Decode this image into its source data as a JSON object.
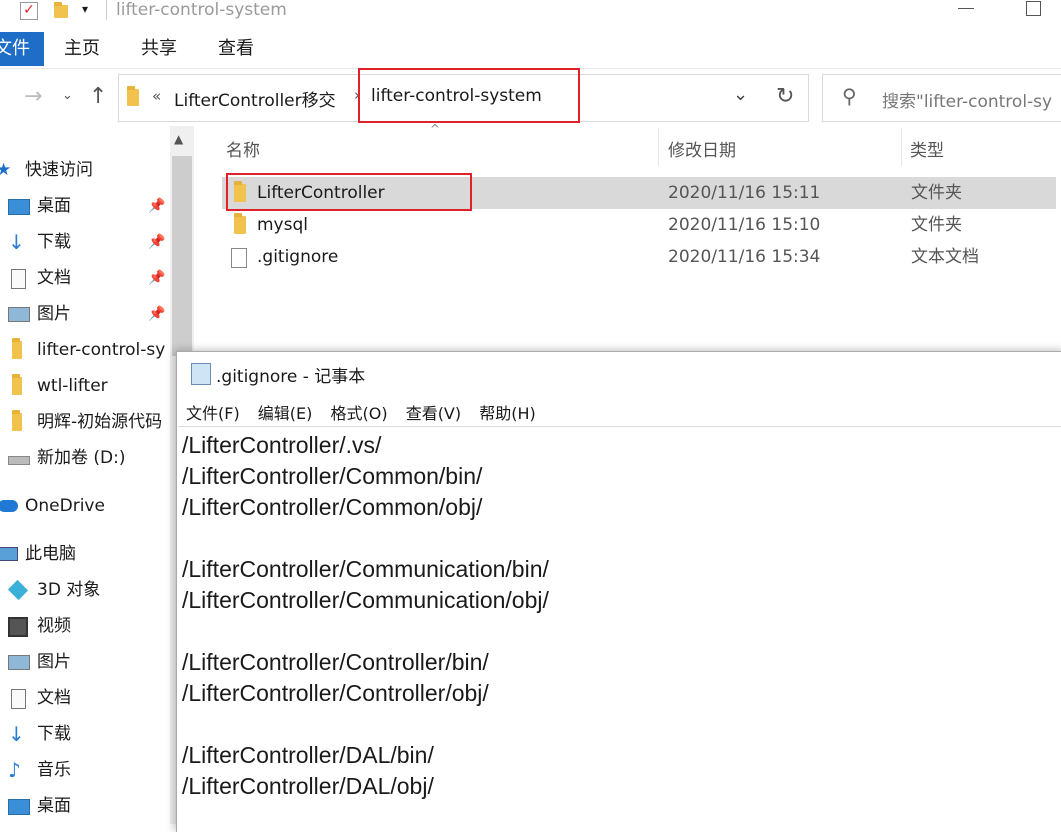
{
  "window": {
    "title": "lifter-control-system"
  },
  "ribbon": {
    "file": "文件",
    "home": "主页",
    "share": "共享",
    "view": "查看"
  },
  "nav": {
    "breadcrumb_sep": "«",
    "crumb_parent": "LifterController移交",
    "crumb_current": "lifter-control-system",
    "search_placeholder": "搜索\"lifter-control-sy"
  },
  "columns": {
    "name": "名称",
    "date": "修改日期",
    "type": "类型"
  },
  "files": [
    {
      "name": "LifterController",
      "date": "2020/11/16 15:11",
      "type": "文件夹",
      "icon": "folder-icon"
    },
    {
      "name": "mysql",
      "date": "2020/11/16 15:10",
      "type": "文件夹",
      "icon": "folder-icon"
    },
    {
      "name": ".gitignore",
      "date": "2020/11/16 15:34",
      "type": "文本文档",
      "icon": "text-file-icon"
    }
  ],
  "sidebar": {
    "quick_access": "快速访问",
    "items": [
      {
        "label": "桌面",
        "icon": "desktop-icon",
        "pinned": true
      },
      {
        "label": "下载",
        "icon": "download-icon",
        "pinned": true
      },
      {
        "label": "文档",
        "icon": "document-icon",
        "pinned": true
      },
      {
        "label": "图片",
        "icon": "picture-icon",
        "pinned": true
      },
      {
        "label": "lifter-control-sy",
        "icon": "folder-icon",
        "pinned": false
      },
      {
        "label": "wtl-lifter",
        "icon": "folder-icon",
        "pinned": false
      },
      {
        "label": "明辉-初始源代码",
        "icon": "folder-icon",
        "pinned": false
      },
      {
        "label": "新加卷 (D:)",
        "icon": "drive-icon",
        "pinned": false
      }
    ],
    "onedrive": "OneDrive",
    "this_pc": "此电脑",
    "pc_items": [
      {
        "label": "3D 对象",
        "icon": "cube-icon"
      },
      {
        "label": "视频",
        "icon": "video-icon"
      },
      {
        "label": "图片",
        "icon": "picture-icon"
      },
      {
        "label": "文档",
        "icon": "document-icon"
      },
      {
        "label": "下载",
        "icon": "download-icon"
      },
      {
        "label": "音乐",
        "icon": "music-icon"
      },
      {
        "label": "桌面",
        "icon": "desktop-icon"
      }
    ]
  },
  "notepad": {
    "title": ".gitignore - 记事本",
    "menu": [
      "文件(F)",
      "编辑(E)",
      "格式(O)",
      "查看(V)",
      "帮助(H)"
    ],
    "content": "/LifterController/.vs/\n/LifterController/Common/bin/\n/LifterController/Common/obj/\n\n/LifterController/Communication/bin/\n/LifterController/Communication/obj/\n\n/LifterController/Controller/bin/\n/LifterController/Controller/obj/\n\n/LifterController/DAL/bin/\n/LifterController/DAL/obj/"
  },
  "colors": {
    "accent": "#1e6ec8",
    "highlight": "#e0202a",
    "selected_row": "#d9d9d9",
    "folder": "#f2c24f"
  }
}
